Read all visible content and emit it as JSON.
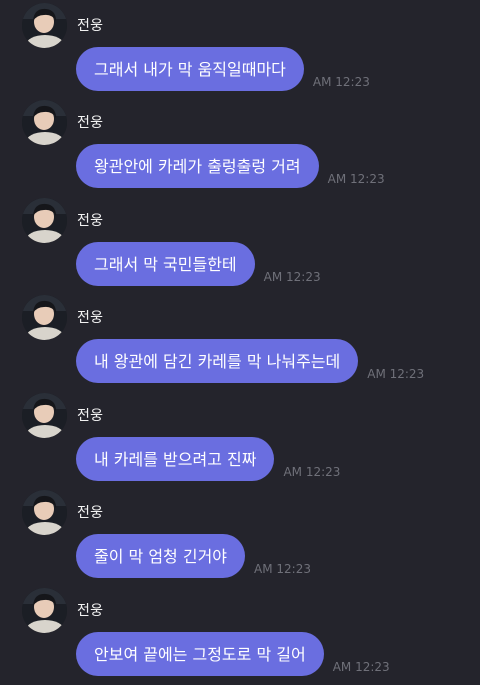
{
  "messages": [
    {
      "sender": "전웅",
      "text": "그래서 내가 막 움직일때마다",
      "time": "AM 12:23"
    },
    {
      "sender": "전웅",
      "text": "왕관안에 카레가 출렁출렁 거려",
      "time": "AM 12:23"
    },
    {
      "sender": "전웅",
      "text": "그래서 막 국민들한테",
      "time": "AM 12:23"
    },
    {
      "sender": "전웅",
      "text": "내 왕관에 담긴 카레를 막 나눠주는데",
      "time": "AM 12:23"
    },
    {
      "sender": "전웅",
      "text": "내 카레를 받으려고 진짜",
      "time": "AM 12:23"
    },
    {
      "sender": "전웅",
      "text": "줄이 막 엄청 긴거야",
      "time": "AM 12:23"
    },
    {
      "sender": "전웅",
      "text": "안보여 끝에는 그정도로 막 길어",
      "time": "AM 12:23"
    }
  ],
  "colors": {
    "background": "#24242c",
    "bubble": "#6a6ee0",
    "bubble_text": "#ffffff",
    "timestamp": "#6f7079"
  },
  "icons": {
    "avatar": "profile-photo"
  }
}
